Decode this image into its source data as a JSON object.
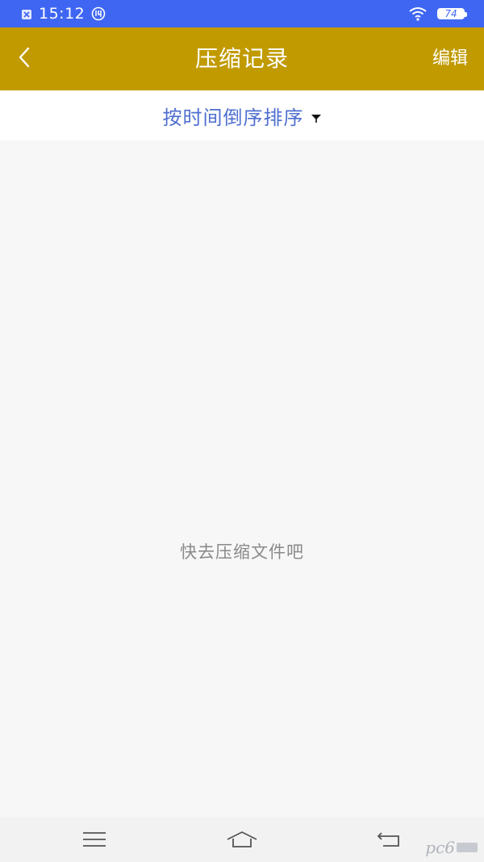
{
  "status_bar": {
    "time": "15:12",
    "battery_level": "74",
    "icons": [
      "sim-icon",
      "usb-debug-icon",
      "wifi-icon",
      "battery-icon"
    ]
  },
  "app_bar": {
    "title": "压缩记录",
    "back_icon": "chevron-left-icon",
    "edit_label": "编辑"
  },
  "sort_bar": {
    "label": "按时间倒序排序",
    "icon": "filter-triangle-icon"
  },
  "content": {
    "empty_message": "快去压缩文件吧"
  },
  "nav_bar": {
    "icons": [
      "menu-icon",
      "home-icon",
      "back-icon"
    ]
  },
  "watermark": {
    "text": "pc6"
  },
  "colors": {
    "status_bar": "#3f66f3",
    "app_bar": "#c19a00",
    "sort_text": "#4f6fd0",
    "empty_text": "#8a8a8a",
    "background": "#f7f7f7"
  }
}
